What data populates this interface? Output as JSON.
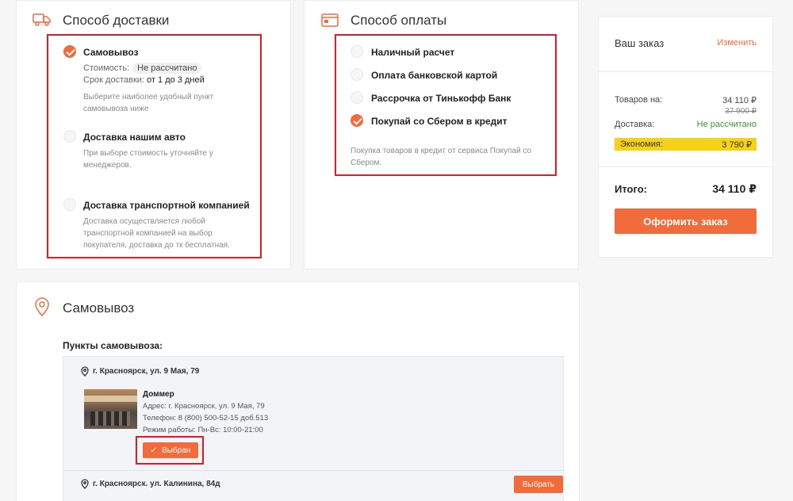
{
  "delivery": {
    "title": "Способ доставки",
    "options": [
      {
        "label": "Самовывоз",
        "checked": true
      },
      {
        "label": "Доставка нашим авто",
        "checked": false
      },
      {
        "label": "Доставка транспортной компанией",
        "checked": false
      }
    ],
    "cost_label": "Стоимость:",
    "cost_value": "Не рассчитано",
    "term_label": "Срок доставки:",
    "term_value": "от 1 до 3 дней",
    "pickup_hint_1": "Выберите наиболее удобный пункт",
    "pickup_hint_2": "самовывоза ниже",
    "auto_hint_1": "При выборе стоимость уточняйте у",
    "auto_hint_2": "менеджеров.",
    "tk_hint_1": "Доставка осуществляется любой",
    "tk_hint_2": "транспортной компанией на выбор",
    "tk_hint_3": "покупателя, доставка до тк бесплатная."
  },
  "payment": {
    "title": "Способ оплаты",
    "options": [
      {
        "label": "Наличный расчет",
        "checked": false
      },
      {
        "label": "Оплата банковской картой",
        "checked": false
      },
      {
        "label": "Рассрочка от Тинькофф Банк",
        "checked": false
      },
      {
        "label": "Покупай со Сбером в кредит",
        "checked": true
      }
    ],
    "note_1": "Покупка товаров в кредит от сервиса Покупай со",
    "note_2": "Сбером."
  },
  "order": {
    "title": "Ваш заказ",
    "edit_link": "Изменить",
    "goods_label": "Товаров на:",
    "goods_value": "34 110 ₽",
    "goods_old": "37 900 ₽",
    "delivery_label": "Доставка:",
    "delivery_value": "Не рассчитано",
    "economy_label": "Экономия:",
    "economy_value": "3 790 ₽",
    "total_label": "Итого:",
    "total_value": "34 110 ₽",
    "checkout_button": "Оформить заказ"
  },
  "pickup": {
    "title": "Самовывоз",
    "points_header": "Пункты самовывоза:",
    "points": [
      {
        "address": "г. Красноярск, ул. 9 Мая, 79",
        "store_name": "Доммер",
        "addr_line": "Адрес: г. Красноярск, ул. 9 Мая, 79",
        "phone_line": "Телефон: 8 (800) 500-52-15 доб.513",
        "hours_line": "Режим работы: Пн-Вс: 10:00-21:00",
        "selected_label": "Выбран"
      },
      {
        "address": "г. Красноярск. ул. Калинина, 84д",
        "choose_label": "Выбрать"
      }
    ]
  },
  "colors": {
    "accent": "#f26b3a",
    "highlight": "#f5d215",
    "green": "#3a9a3a",
    "annotation": "#e01b24"
  }
}
